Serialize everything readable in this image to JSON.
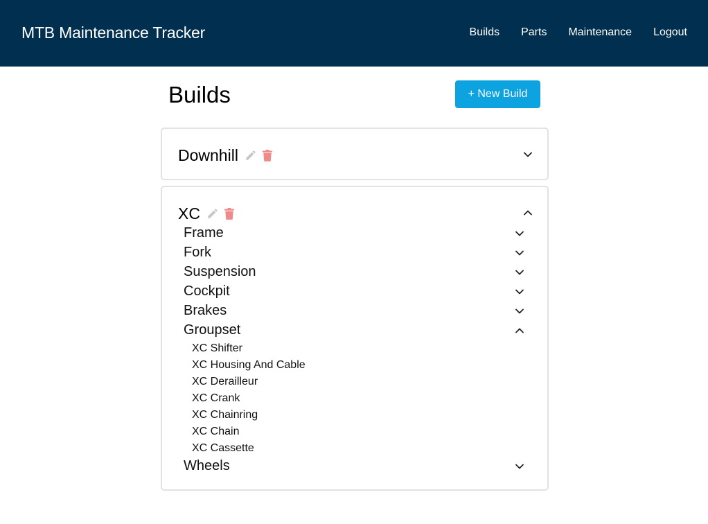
{
  "navbar": {
    "brand": "MTB Maintenance Tracker",
    "links": [
      "Builds",
      "Parts",
      "Maintenance",
      "Logout"
    ]
  },
  "page": {
    "title": "Builds",
    "new_button": "+ New Build"
  },
  "builds": [
    {
      "name": "Downhill",
      "expanded": false
    },
    {
      "name": "XC",
      "expanded": true,
      "sections": [
        {
          "name": "Frame",
          "expanded": false
        },
        {
          "name": "Fork",
          "expanded": false
        },
        {
          "name": "Suspension",
          "expanded": false
        },
        {
          "name": "Cockpit",
          "expanded": false
        },
        {
          "name": "Brakes",
          "expanded": false
        },
        {
          "name": "Groupset",
          "expanded": true,
          "parts": [
            "XC Shifter",
            "XC Housing And Cable",
            "XC Derailleur",
            "XC Crank",
            "XC Chainring",
            "XC Chain",
            "XC Cassette"
          ]
        },
        {
          "name": "Wheels",
          "expanded": false
        }
      ]
    }
  ],
  "colors": {
    "navbar": "#002f4f",
    "primary_button": "#0da2e0",
    "edit_icon": "#c8c8c8",
    "delete_icon": "#f08a8a",
    "card_border": "#e2e2e2"
  },
  "icons": {
    "edit": "pencil-icon",
    "delete": "trash-icon",
    "collapsed": "chevron-down-icon",
    "expanded": "chevron-up-icon"
  }
}
